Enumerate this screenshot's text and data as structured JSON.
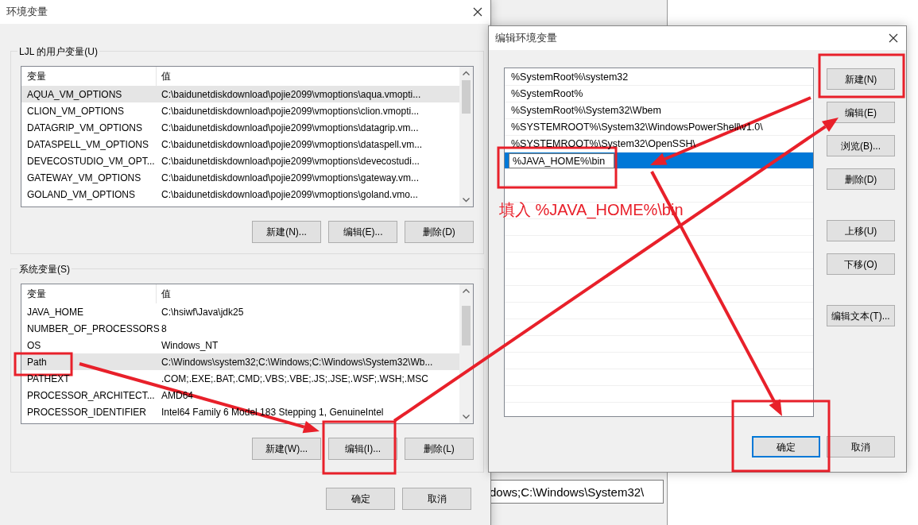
{
  "env_dialog": {
    "title": "环境变量",
    "groups": [
      {
        "title": "LJL 的用户变量(U)",
        "columns": [
          "变量",
          "值"
        ],
        "rows": [
          {
            "name": "AQUA_VM_OPTIONS",
            "value": "C:\\baidunetdiskdownload\\pojie2099\\vmoptions\\aqua.vmopti...",
            "selected": true
          },
          {
            "name": "CLION_VM_OPTIONS",
            "value": "C:\\baidunetdiskdownload\\pojie2099\\vmoptions\\clion.vmopti...",
            "selected": false
          },
          {
            "name": "DATAGRIP_VM_OPTIONS",
            "value": "C:\\baidunetdiskdownload\\pojie2099\\vmoptions\\datagrip.vm...",
            "selected": false
          },
          {
            "name": "DATASPELL_VM_OPTIONS",
            "value": "C:\\baidunetdiskdownload\\pojie2099\\vmoptions\\dataspell.vm...",
            "selected": false
          },
          {
            "name": "DEVECOSTUDIO_VM_OPT...",
            "value": "C:\\baidunetdiskdownload\\pojie2099\\vmoptions\\devecostudi...",
            "selected": false
          },
          {
            "name": "GATEWAY_VM_OPTIONS",
            "value": "C:\\baidunetdiskdownload\\pojie2099\\vmoptions\\gateway.vm...",
            "selected": false
          },
          {
            "name": "GOLAND_VM_OPTIONS",
            "value": "C:\\baidunetdiskdownload\\pojie2099\\vmoptions\\goland.vmo...",
            "selected": false
          }
        ],
        "buttons": [
          "新建(N)...",
          "编辑(E)...",
          "删除(D)"
        ]
      },
      {
        "title": "系统变量(S)",
        "columns": [
          "变量",
          "值"
        ],
        "rows": [
          {
            "name": "JAVA_HOME",
            "value": "C:\\hsiwf\\Java\\jdk25",
            "selected": false
          },
          {
            "name": "NUMBER_OF_PROCESSORS",
            "value": "8",
            "selected": false
          },
          {
            "name": "OS",
            "value": "Windows_NT",
            "selected": false
          },
          {
            "name": "Path",
            "value": "C:\\Windows\\system32;C:\\Windows;C:\\Windows\\System32\\Wb...",
            "selected": true
          },
          {
            "name": "PATHEXT",
            "value": ".COM;.EXE;.BAT;.CMD;.VBS;.VBE;.JS;.JSE;.WSF;.WSH;.MSC",
            "selected": false
          },
          {
            "name": "PROCESSOR_ARCHITECT...",
            "value": "AMD64",
            "selected": false
          },
          {
            "name": "PROCESSOR_IDENTIFIER",
            "value": "Intel64 Family 6 Model 183 Stepping 1, GenuineIntel",
            "selected": false
          }
        ],
        "buttons": [
          "新建(W)...",
          "编辑(I)...",
          "删除(L)"
        ]
      }
    ],
    "footer_buttons": [
      {
        "label": "确定",
        "default": false
      },
      {
        "label": "取消",
        "default": false
      }
    ]
  },
  "edit_dialog": {
    "title": "编辑环境变量",
    "entries": [
      {
        "text": "%SystemRoot%\\system32",
        "selected": false
      },
      {
        "text": "%SystemRoot%",
        "selected": false
      },
      {
        "text": "%SystemRoot%\\System32\\Wbem",
        "selected": false
      },
      {
        "text": "%SYSTEMROOT%\\System32\\WindowsPowerShell\\v1.0\\",
        "selected": false
      },
      {
        "text": "%SYSTEMROOT%\\System32\\OpenSSH\\",
        "selected": false
      },
      {
        "text": "%JAVA_HOME%\\bin",
        "selected": true
      }
    ],
    "button_groups": [
      [
        "新建(N)",
        "编辑(E)",
        "浏览(B)...",
        "删除(D)"
      ],
      [
        "上移(U)",
        "下移(O)"
      ],
      [
        "编辑文本(T)..."
      ]
    ],
    "footer_buttons": [
      {
        "label": "确定",
        "default": true
      },
      {
        "label": "取消",
        "default": false
      }
    ]
  },
  "background_window": {
    "field_value": "dows;C:\\Windows\\System32\\"
  },
  "annotation": {
    "text": "填入 %JAVA_HOME%\\bin"
  }
}
